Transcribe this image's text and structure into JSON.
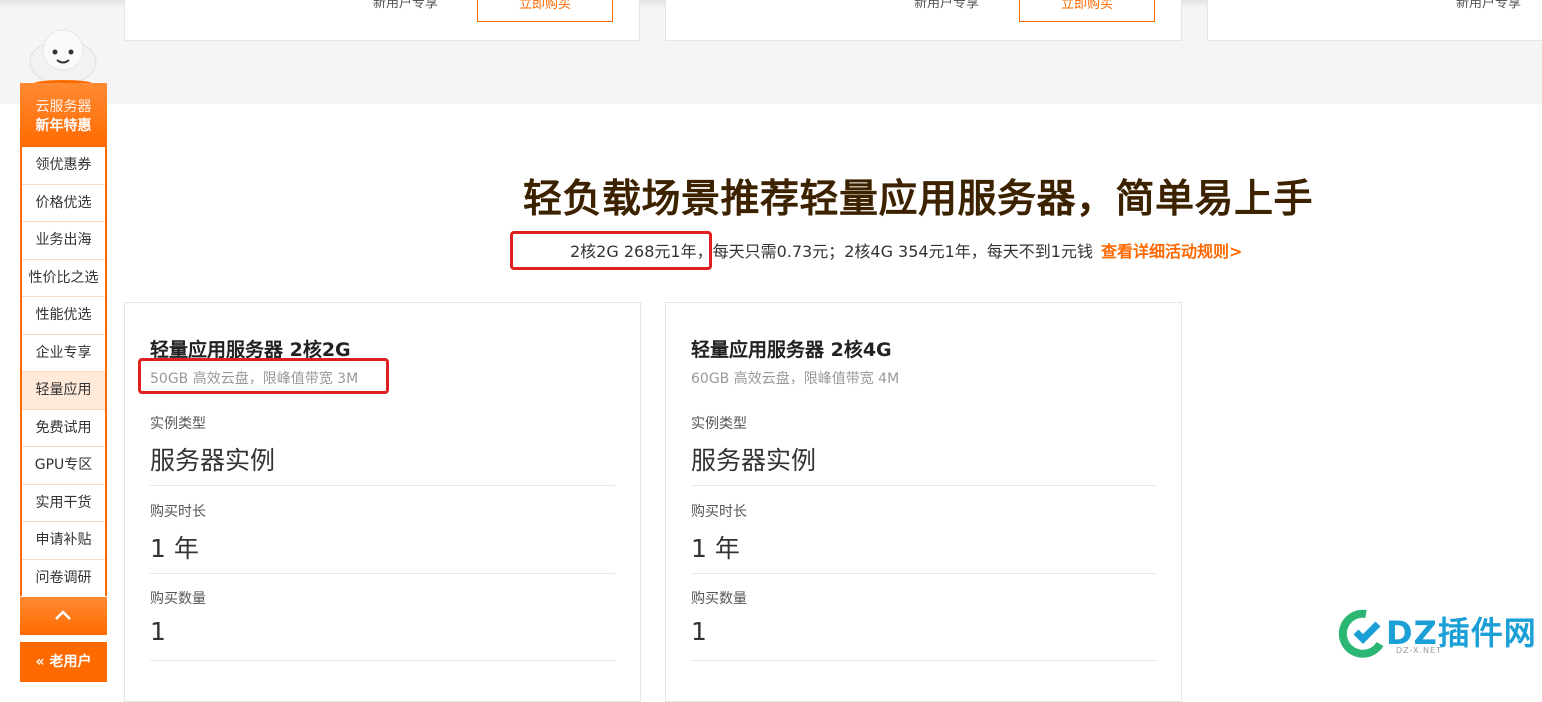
{
  "top_cards": [
    {
      "cut_text": "新用户专享",
      "cut_button": "立即购买"
    },
    {
      "cut_text": "新用户专享",
      "cut_button": "立即购买"
    },
    {
      "cut_text": "新用户专享"
    }
  ],
  "sidebar": {
    "head_line1": "云服务器",
    "head_line2": "新年特惠",
    "items": [
      {
        "label": "领优惠券"
      },
      {
        "label": "价格优选"
      },
      {
        "label": "业务出海"
      },
      {
        "label": "性价比之选"
      },
      {
        "label": "性能优选"
      },
      {
        "label": "企业专享"
      },
      {
        "label": "轻量应用",
        "active": true
      },
      {
        "label": "免费试用"
      },
      {
        "label": "GPU专区"
      },
      {
        "label": "实用干货"
      },
      {
        "label": "申请补贴"
      },
      {
        "label": "问卷调研"
      }
    ],
    "old_user_label": "« 老用户"
  },
  "section": {
    "headline": "轻负载场景推荐轻量应用服务器，简单易上手",
    "subline_highlight": "2核2G 268元1年，",
    "subline_rest": "每天只需0.73元；2核4G 354元1年，每天不到1元钱",
    "rules_link": "查看详细活动规则>"
  },
  "products": [
    {
      "title": "轻量应用服务器 2核2G",
      "desc": "50GB 高效云盘，限峰值带宽 3M",
      "instance_type_label": "实例类型",
      "instance_type_value": "服务器实例",
      "duration_label": "购买时长",
      "duration_value": "1 年",
      "quantity_label": "购买数量",
      "quantity_value": "1"
    },
    {
      "title": "轻量应用服务器 2核4G",
      "desc": "60GB 高效云盘，限峰值带宽 4M",
      "instance_type_label": "实例类型",
      "instance_type_value": "服务器实例",
      "duration_label": "购买时长",
      "duration_value": "1 年",
      "quantity_label": "购买数量",
      "quantity_value": "1"
    }
  ],
  "watermark": {
    "logo_text": "DZ插件网",
    "logo_sub": "DZ-X.NET"
  },
  "colors": {
    "accent": "#ff6a00",
    "headline": "#3d2200",
    "highlight_box": "#e02020"
  }
}
